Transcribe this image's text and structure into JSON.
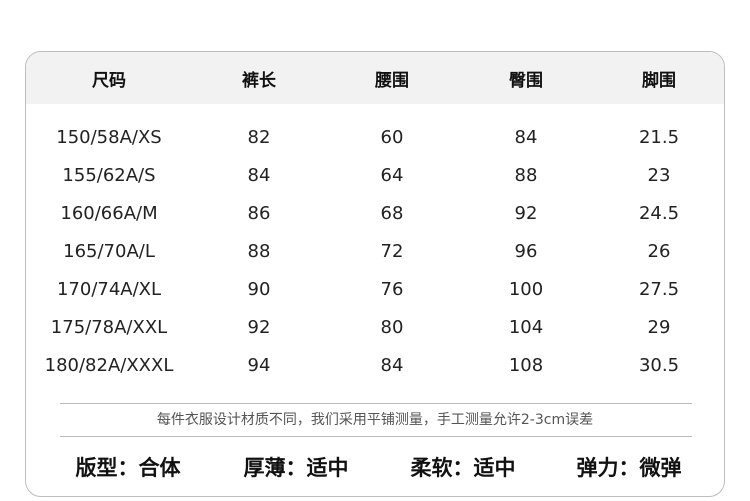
{
  "table": {
    "headers": [
      "尺码",
      "裤长",
      "腰围",
      "臀围",
      "脚围"
    ],
    "rows": [
      [
        "150/58A/XS",
        "82",
        "60",
        "84",
        "21.5"
      ],
      [
        "155/62A/S",
        "84",
        "64",
        "88",
        "23"
      ],
      [
        "160/66A/M",
        "86",
        "68",
        "92",
        "24.5"
      ],
      [
        "165/70A/L",
        "88",
        "72",
        "96",
        "26"
      ],
      [
        "170/74A/XL",
        "90",
        "76",
        "100",
        "27.5"
      ],
      [
        "175/78A/XXL",
        "92",
        "80",
        "104",
        "29"
      ],
      [
        "180/82A/XXXL",
        "94",
        "84",
        "108",
        "30.5"
      ]
    ]
  },
  "note": "每件衣服设计材质不同，我们采用平铺测量，手工测量允许2-3cm误差",
  "attributes": [
    {
      "label": "版型：",
      "value": "合体"
    },
    {
      "label": "厚薄：",
      "value": "适中"
    },
    {
      "label": "柔软：",
      "value": "适中"
    },
    {
      "label": "弹力：",
      "value": "微弹"
    }
  ],
  "colors": {
    "header_bg": "#f2f2f2",
    "border": "#bdbdbd",
    "note_text": "#555555"
  }
}
